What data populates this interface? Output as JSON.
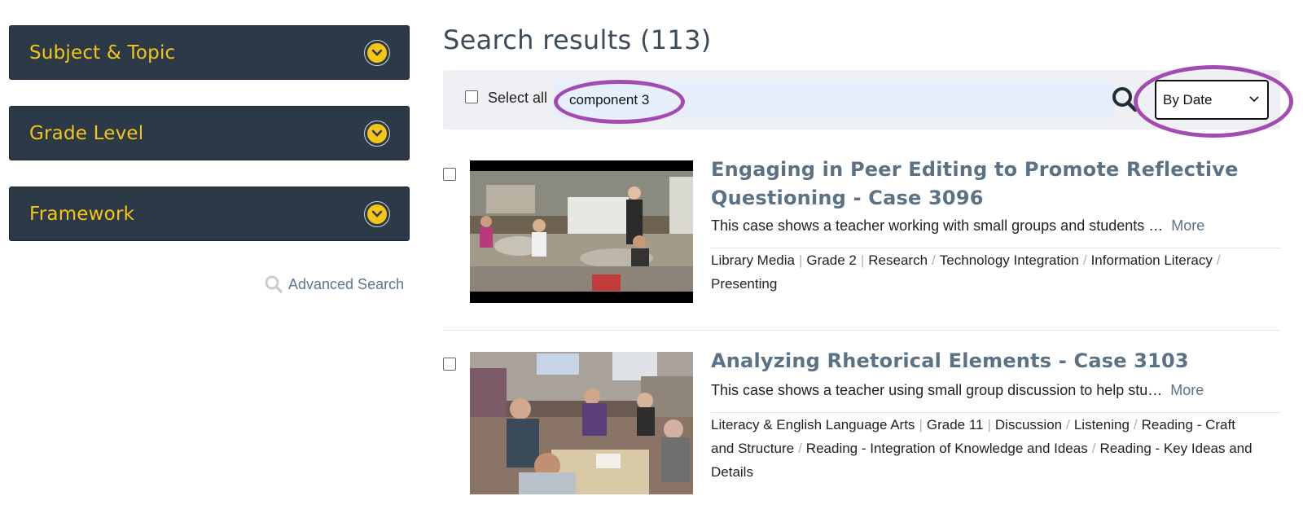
{
  "sidebar": {
    "facets": [
      {
        "label": "Subject & Topic"
      },
      {
        "label": "Grade Level"
      },
      {
        "label": "Framework"
      }
    ],
    "advanced_search": "Advanced Search"
  },
  "results": {
    "title": "Search results (113)",
    "toolbar": {
      "select_all": "Select all",
      "search_value": "component 3",
      "sort_selected": "By Date"
    },
    "items": [
      {
        "title": "Engaging in Peer Editing to Promote Reflective Questioning - Case 3096",
        "description": "This case shows a teacher working with small groups and students …",
        "more": "More",
        "tags_line1": [
          "Library Media",
          "Grade 2",
          "Research",
          "Technology Integration",
          "Information Literacy"
        ],
        "tags_line2": [
          "Presenting"
        ]
      },
      {
        "title": "Analyzing Rhetorical Elements - Case 3103",
        "description": "This case shows a teacher using small group discussion to help stu…",
        "more": "More",
        "tags_line1": [
          "Literacy & English Language Arts",
          "Grade 11",
          "Discussion",
          "Listening",
          "Reading - Craft"
        ],
        "tags_line2": [
          "and Structure",
          "Reading - Integration of Knowledge and Ideas",
          "Reading - Key Ideas and"
        ],
        "tags_line3": [
          "Details"
        ]
      }
    ]
  },
  "colors": {
    "facet_bg": "#2c3a47",
    "facet_text": "#f5c518",
    "title_link": "#5b7186",
    "annotation": "#a44bb3"
  }
}
